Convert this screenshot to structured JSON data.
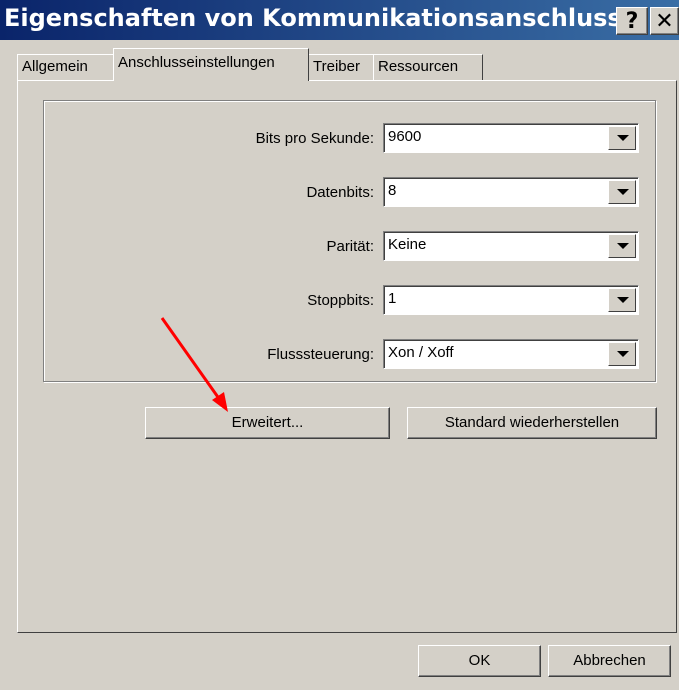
{
  "window": {
    "title": "Eigenschaften von Kommunikationsanschluss ...",
    "help_glyph": "?",
    "close_glyph": "✕"
  },
  "tabs": [
    {
      "label": "Allgemein",
      "active": false
    },
    {
      "label": "Anschlusseinstellungen",
      "active": true
    },
    {
      "label": "Treiber",
      "active": false
    },
    {
      "label": "Ressourcen",
      "active": false
    }
  ],
  "settings": [
    {
      "label": "Bits pro Sekunde:",
      "value": "9600"
    },
    {
      "label": "Datenbits:",
      "value": "8"
    },
    {
      "label": "Parität:",
      "value": "Keine"
    },
    {
      "label": "Stoppbits:",
      "value": "1"
    },
    {
      "label": "Flusssteuerung:",
      "value": "Xon / Xoff"
    }
  ],
  "buttons": {
    "advanced": "Erweitert...",
    "restore_defaults": "Standard wiederherstellen",
    "ok": "OK",
    "cancel": "Abbrechen"
  },
  "colors": {
    "face": "#d4d0c8",
    "title_start": "#0a246a",
    "title_end": "#3a6ea5",
    "annotation_arrow": "#ff0000"
  }
}
